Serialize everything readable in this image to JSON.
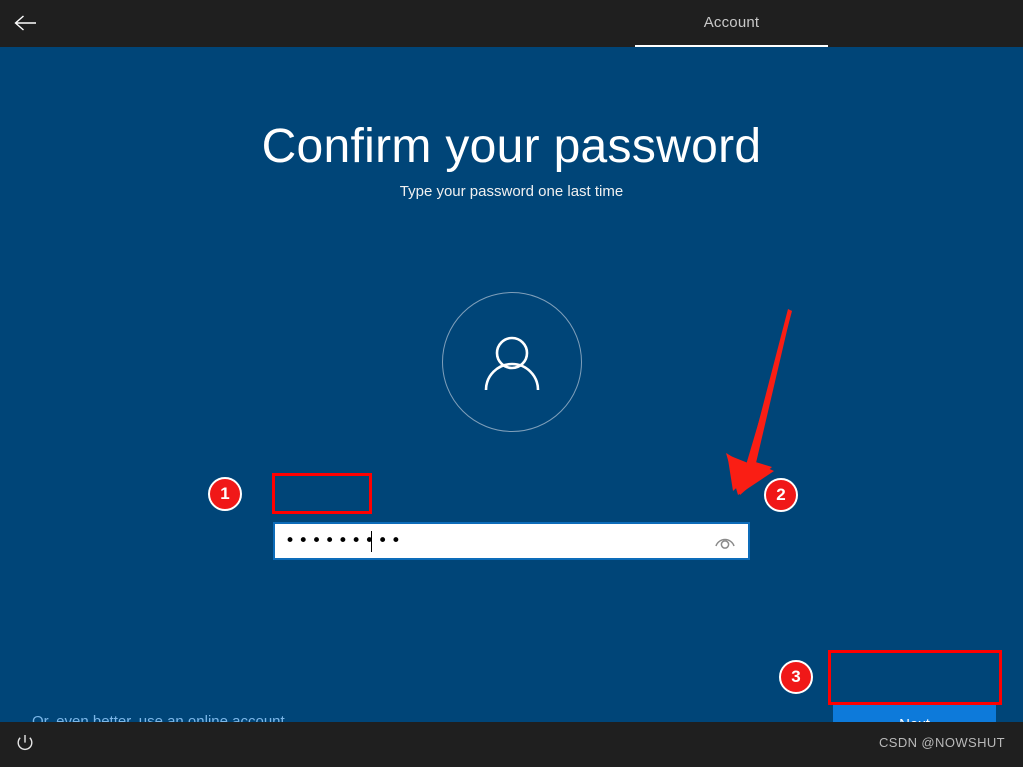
{
  "header": {
    "back_icon": "back-arrow-icon",
    "tab_label": "Account"
  },
  "main": {
    "title": "Confirm your password",
    "subtitle": "Type your password one last time",
    "avatar_icon": "person-icon"
  },
  "password": {
    "value": "•••••••••",
    "dot_count": 9,
    "reveal_icon": "eye-icon"
  },
  "actions": {
    "online_account_link": "Or, even better, use an online account",
    "next_label": "Next"
  },
  "footer": {
    "power_icon": "power-icon",
    "watermark": "CSDN @NOWSHUT"
  },
  "annotations": {
    "badge_1": "1",
    "badge_2": "2",
    "badge_3": "3",
    "arrow_icon": "red-arrow-icon",
    "accent_red": "#ff0000"
  },
  "colors": {
    "background_blue": "#004578",
    "chrome_dark": "#1f1f1f",
    "button_blue": "#0d7ada",
    "link_blue": "#7cb7e8",
    "badge_red": "#f01818"
  }
}
